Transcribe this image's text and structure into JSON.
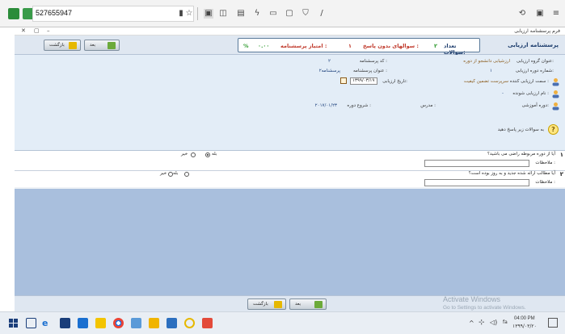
{
  "browser": {
    "address": "527655947"
  },
  "window": {
    "title": "فرم پرسشنامه ارزیابی",
    "minimize": "–",
    "maximize": "▢",
    "close": "✕"
  },
  "header": {
    "title": "پرسشنامه ارزیابی",
    "question_count_label": "تعداد سوالات:",
    "question_count_value": "۲",
    "unanswered_label": "سوالهای بدون پاسخ :",
    "unanswered_value": "۱",
    "score_label": "امتیاز پرسشنامه :",
    "score_value": "۰.۰۰",
    "score_unit": "%",
    "next_label": "بعد",
    "back_label": "بازگشت"
  },
  "info": {
    "group_title_label": "عنوان گروه ارزیابی:",
    "group_title_value": "ارزشیابی دانشجو از دوره",
    "questionnaire_code_label": "کد پرسشنامه :",
    "questionnaire_code_value": "۲",
    "period_number_label": "شماره دوره ارزیابی:",
    "period_number_value": "۱",
    "questionnaire_title_label": "عنوان پرسشنامه :",
    "questionnaire_title_value": "پرسشنامه۲",
    "evaluator_role_label": "سمت ارزیابی کننده :",
    "evaluator_role_value": "سرپرست تضمین کیفیت",
    "eval_date_label": "تاریخ ارزیابی:",
    "eval_date_value": "۱۳۹۹/۰۳/۱۹",
    "evaluated_name_label": "نام ارزیابی شونده :",
    "evaluated_name_value": "-",
    "course_label": "دوره آموزشی:",
    "teacher_label": "مدرس :",
    "start_label": "شروع دوره :",
    "start_value": "۲۰۱۷/۰۱/۲۳"
  },
  "questions": {
    "prompt": "به سوالات زیر پاسخ دهید",
    "items": [
      {
        "number": "۱",
        "text": "آیا از دوره مربوطه راضی می باشید؟",
        "notes_label": "ملاحظات :",
        "opt_yes": "بله",
        "opt_no": "خیر"
      },
      {
        "number": "۲",
        "text": "آیا مطالب ارائه شده جدید و به روز بوده است؟",
        "notes_label": "ملاحظات :",
        "opt_yes": "بله",
        "opt_no": "خیر"
      }
    ]
  },
  "footer": {
    "next_label": "بعد",
    "back_label": "بازگشت"
  },
  "taskbar": {
    "time": "04:00 PM",
    "date": "۱۳۹۹/۰۳/۲۰",
    "lang": "fa",
    "watermark_title": "Activate Windows",
    "watermark_sub": "Go to Settings to activate Windows."
  },
  "colors": {
    "accent": "#1c3c6c",
    "panel": "#e3edf7",
    "empty": "#a9bfdd",
    "green": "#2e9a2e"
  }
}
